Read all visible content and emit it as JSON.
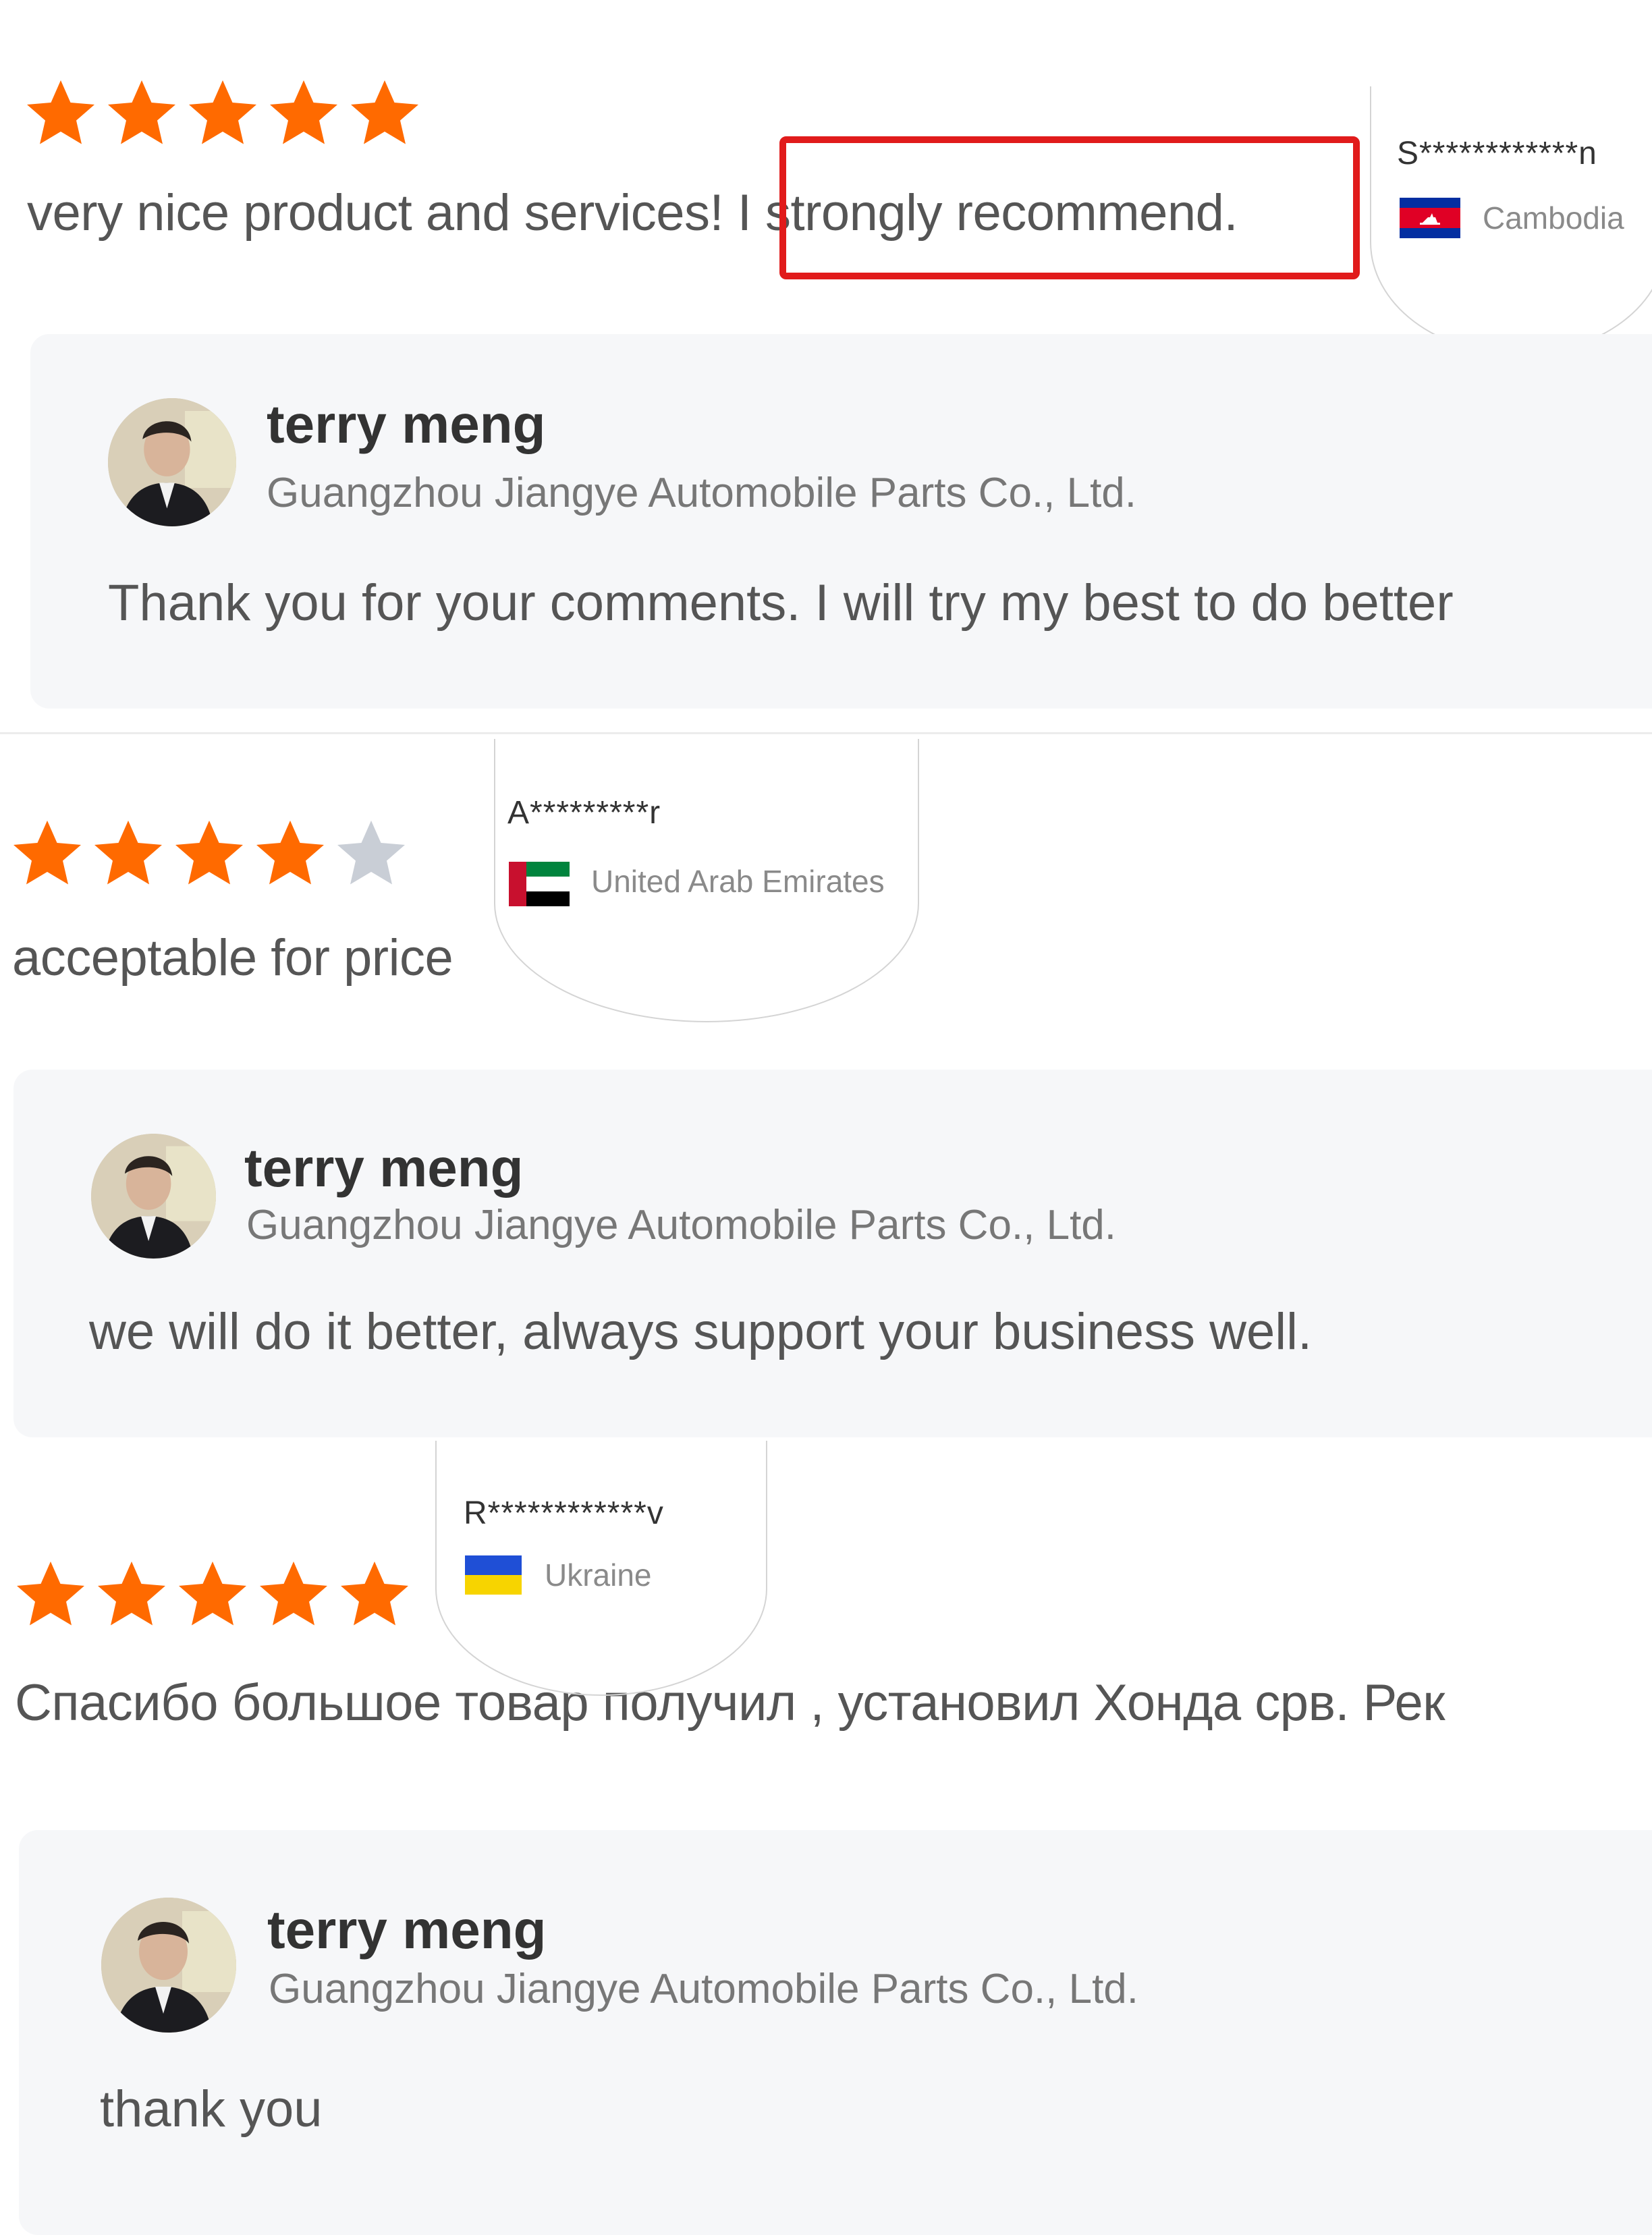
{
  "reviews": [
    {
      "rating": 5,
      "text_before": "very nice product and services! ",
      "text_highlight": "I strongly recommend.",
      "reviewer": "S************n",
      "country": "Cambodia",
      "country_flag": "cambodia-flag",
      "reply": {
        "name": "terry meng",
        "company": "Guangzhou Jiangye Automobile Parts Co., Ltd.",
        "text": "Thank you for your comments. I will try my best to do better"
      }
    },
    {
      "rating": 4,
      "text": "acceptable for price",
      "reviewer": "A*********r",
      "country": "United Arab Emirates",
      "country_flag": "uae-flag",
      "reply": {
        "name": "terry meng",
        "company": "Guangzhou Jiangye Automobile Parts Co., Ltd.",
        "text": "we will do it better, always support your business well."
      }
    },
    {
      "rating": 5,
      "text": "Спасибо большое товар получил , установил Хонда срв. Рек",
      "reviewer": "R************v",
      "country": "Ukraine",
      "country_flag": "ukraine-flag",
      "reply": {
        "name": "terry meng",
        "company": "Guangzhou Jiangye Automobile Parts Co., Ltd.",
        "text": "thank you"
      }
    }
  ],
  "colors": {
    "star_filled": "#ff6a00",
    "star_empty": "#c9ced6",
    "highlight": "#e11b1b",
    "reply_bg": "#f6f7f9"
  }
}
